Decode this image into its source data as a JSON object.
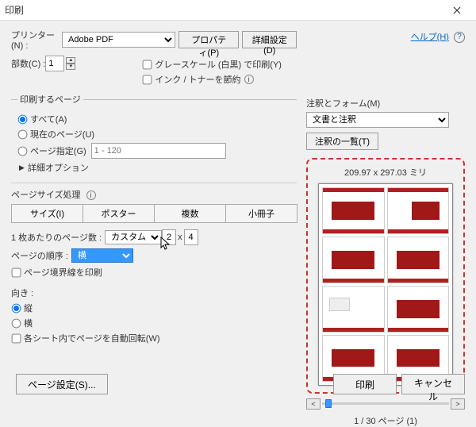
{
  "window": {
    "title": "印刷",
    "help_label": "ヘルプ(H)"
  },
  "printer": {
    "label": "プリンター(N) :",
    "selected": "Adobe PDF",
    "properties_btn": "プロパティ(P)",
    "advanced_btn": "詳細設定(D)"
  },
  "copies": {
    "label": "部数(C) :",
    "value": "1"
  },
  "options": {
    "grayscale_label": "グレースケール (白黒) で印刷(Y)",
    "savetoner_label": "インク / トナーを節約"
  },
  "pagerange": {
    "legend": "印刷するページ",
    "all": "すべて(A)",
    "current": "現在のページ(U)",
    "range": "ページ指定(G)",
    "range_placeholder": "1 - 120",
    "more": "詳細オプション"
  },
  "sizing": {
    "legend": "ページサイズ処理",
    "size_btn": "サイズ(I)",
    "poster_btn": "ポスター",
    "multi_btn": "複数",
    "booklet_btn": "小冊子"
  },
  "perpage": {
    "label": "1 枚あたりのページ数 :",
    "mode": "カスタム...",
    "cols": "2",
    "by": "x",
    "rows": "4"
  },
  "order": {
    "label": "ページの順序 :",
    "value": "横"
  },
  "borders_label": "ページ境界線を印刷",
  "orient": {
    "legend": "向き :",
    "portrait": "縦",
    "landscape": "横",
    "autorotate": "各シート内でページを自動回転(W)"
  },
  "comments": {
    "legend": "注釈とフォーム(M)",
    "value": "文書と注釈",
    "summary_btn": "注釈の一覧(T)"
  },
  "preview": {
    "dims": "209.97 x 297.03 ミリ",
    "pagecount": "1 / 30 ページ (1)",
    "prev": "<",
    "next": ">"
  },
  "footer": {
    "pagesetup_btn": "ページ設定(S)...",
    "print_btn": "印刷",
    "cancel_btn": "キャンセル"
  }
}
